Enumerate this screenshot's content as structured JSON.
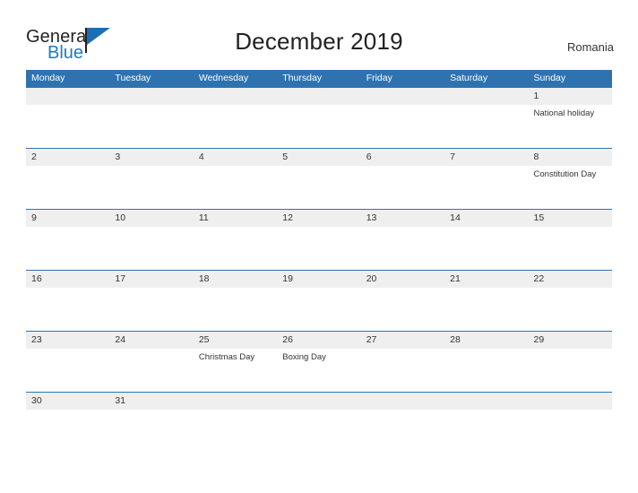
{
  "brand": {
    "name_part1": "General",
    "name_part2": "Blue",
    "flag_icon": "blue-triangle-flag-icon"
  },
  "header": {
    "title": "December 2019",
    "country": "Romania"
  },
  "colors": {
    "header_blue": "#2e73b0",
    "band_gray": "#efefef",
    "logo_blue": "#1e7bc4",
    "text": "#333333"
  },
  "calendar": {
    "weekday_headers": [
      "Monday",
      "Tuesday",
      "Wednesday",
      "Thursday",
      "Friday",
      "Saturday",
      "Sunday"
    ],
    "weeks": [
      {
        "short": false,
        "days": [
          {
            "num": "",
            "event": ""
          },
          {
            "num": "",
            "event": ""
          },
          {
            "num": "",
            "event": ""
          },
          {
            "num": "",
            "event": ""
          },
          {
            "num": "",
            "event": ""
          },
          {
            "num": "",
            "event": ""
          },
          {
            "num": "1",
            "event": "National holiday"
          }
        ]
      },
      {
        "short": false,
        "days": [
          {
            "num": "2",
            "event": ""
          },
          {
            "num": "3",
            "event": ""
          },
          {
            "num": "4",
            "event": ""
          },
          {
            "num": "5",
            "event": ""
          },
          {
            "num": "6",
            "event": ""
          },
          {
            "num": "7",
            "event": ""
          },
          {
            "num": "8",
            "event": "Constitution Day"
          }
        ]
      },
      {
        "short": false,
        "days": [
          {
            "num": "9",
            "event": ""
          },
          {
            "num": "10",
            "event": ""
          },
          {
            "num": "11",
            "event": ""
          },
          {
            "num": "12",
            "event": ""
          },
          {
            "num": "13",
            "event": ""
          },
          {
            "num": "14",
            "event": ""
          },
          {
            "num": "15",
            "event": ""
          }
        ]
      },
      {
        "short": false,
        "days": [
          {
            "num": "16",
            "event": ""
          },
          {
            "num": "17",
            "event": ""
          },
          {
            "num": "18",
            "event": ""
          },
          {
            "num": "19",
            "event": ""
          },
          {
            "num": "20",
            "event": ""
          },
          {
            "num": "21",
            "event": ""
          },
          {
            "num": "22",
            "event": ""
          }
        ]
      },
      {
        "short": false,
        "days": [
          {
            "num": "23",
            "event": ""
          },
          {
            "num": "24",
            "event": ""
          },
          {
            "num": "25",
            "event": "Christmas Day"
          },
          {
            "num": "26",
            "event": "Boxing Day"
          },
          {
            "num": "27",
            "event": ""
          },
          {
            "num": "28",
            "event": ""
          },
          {
            "num": "29",
            "event": ""
          }
        ]
      },
      {
        "short": true,
        "days": [
          {
            "num": "30",
            "event": ""
          },
          {
            "num": "31",
            "event": ""
          },
          {
            "num": "",
            "event": ""
          },
          {
            "num": "",
            "event": ""
          },
          {
            "num": "",
            "event": ""
          },
          {
            "num": "",
            "event": ""
          },
          {
            "num": "",
            "event": ""
          }
        ]
      }
    ]
  }
}
